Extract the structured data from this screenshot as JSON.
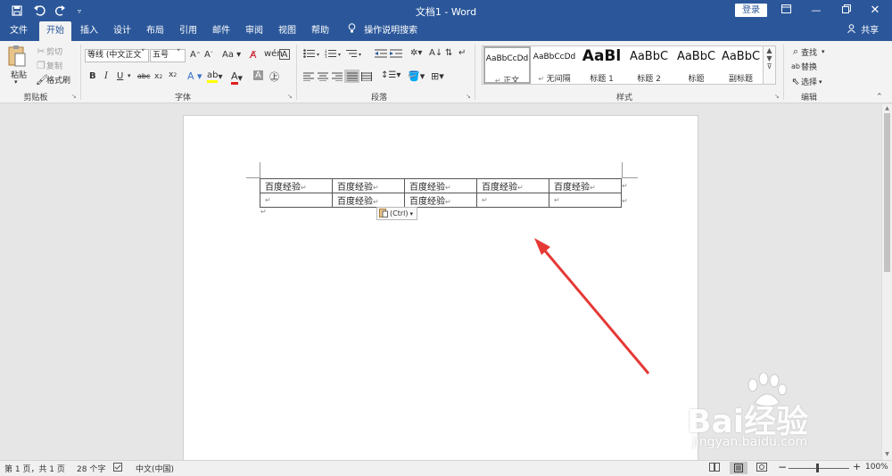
{
  "titlebar": {
    "title": "文档1 - Word",
    "login_label": "登录",
    "colors": {
      "bar": "#2b579a"
    }
  },
  "quick_access": {
    "icons": [
      "save-icon",
      "undo-icon",
      "redo-icon",
      "customize-icon"
    ]
  },
  "tabs": [
    {
      "label": "文件"
    },
    {
      "label": "开始",
      "active": true
    },
    {
      "label": "插入"
    },
    {
      "label": "设计"
    },
    {
      "label": "布局"
    },
    {
      "label": "引用"
    },
    {
      "label": "邮件"
    },
    {
      "label": "审阅"
    },
    {
      "label": "视图"
    },
    {
      "label": "帮助"
    }
  ],
  "tell_me": "操作说明搜索",
  "share": "共享",
  "ribbon": {
    "clipboard": {
      "paste": "粘贴",
      "cut": "剪切",
      "copy": "复制",
      "format_painter": "格式刷",
      "label": "剪贴板"
    },
    "font": {
      "font_name": "等线 (中文正文",
      "font_size": "五号",
      "label": "字体"
    },
    "paragraph": {
      "label": "段落"
    },
    "styles": {
      "label": "样式",
      "items": [
        {
          "sample": "AaBbCcDd",
          "name": "正文",
          "selected": true
        },
        {
          "sample": "AaBbCcDd",
          "name": "无间隔"
        },
        {
          "sample": "AaBl",
          "name": "标题 1"
        },
        {
          "sample": "AaBbC",
          "name": "标题 2"
        },
        {
          "sample": "AaBbC",
          "name": "标题"
        },
        {
          "sample": "AaBbC",
          "name": "副标题"
        }
      ]
    },
    "editing": {
      "find": "查找",
      "replace": "替换",
      "select": "选择",
      "label": "编辑"
    }
  },
  "document": {
    "table": [
      [
        "百度经验",
        "百度经验",
        "百度经验",
        "百度经验",
        "百度经验"
      ],
      [
        "",
        "百度经验",
        "百度经验",
        "",
        ""
      ]
    ],
    "paste_options": "(Ctrl)"
  },
  "annotation": {
    "arrow_color": "#e53935"
  },
  "watermark": {
    "brand": "Bai经验",
    "url": "jingyan.baidu.com"
  },
  "statusbar": {
    "page": "第 1 页，共 1 页",
    "words": "28 个字",
    "language": "中文(中国)",
    "zoom": "100%"
  }
}
